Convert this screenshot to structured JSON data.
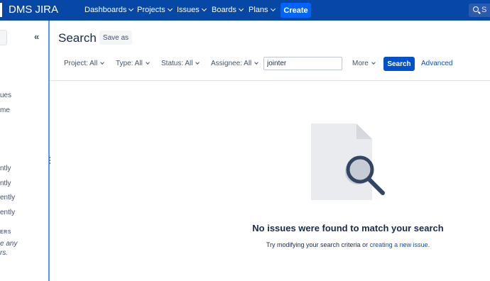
{
  "app": {
    "brand": "DMS JIRA"
  },
  "topnav": {
    "items": [
      "Dashboards",
      "Projects",
      "Issues",
      "Boards",
      "Plans"
    ],
    "create_label": "Create",
    "search_placeholder": "S"
  },
  "sidebar": {
    "items": [
      "ues",
      "me",
      "ntly",
      "ntly",
      "ently",
      "ently"
    ],
    "section_heading": "ERS",
    "note_lines": [
      "e any",
      "rs."
    ]
  },
  "main": {
    "title": "Search",
    "save_as_label": "Save as",
    "filters": [
      "Project: All",
      "Type: All",
      "Status: All",
      "Assignee: All"
    ],
    "query_value": "jointer",
    "more_label": "More",
    "search_label": "Search",
    "advanced_label": "Advanced",
    "empty": {
      "title": "No issues were found to match your search",
      "desc_prefix": "Try modifying your search criteria or ",
      "desc_link": "creating a new issue",
      "desc_suffix": "."
    }
  },
  "colors": {
    "nav_bg": "#0747a6",
    "create_bg": "#0065ff",
    "search_btn": "#0052cc",
    "divider": "#4c9aff"
  }
}
